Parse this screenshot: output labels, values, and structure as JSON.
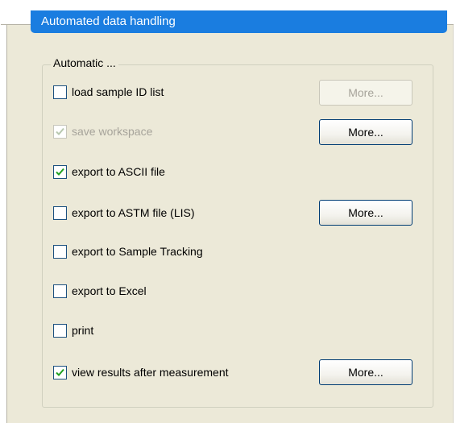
{
  "panel": {
    "title": "Automated data handling"
  },
  "group": {
    "legend": "Automatic ..."
  },
  "options": [
    {
      "label": "load sample ID list",
      "checked": false,
      "enabled": true,
      "more_button": "More...",
      "more_enabled": false
    },
    {
      "label": "save workspace",
      "checked": true,
      "enabled": false,
      "more_button": "More...",
      "more_enabled": true
    },
    {
      "label": "export to ASCII file",
      "checked": true,
      "enabled": true
    },
    {
      "label": "export to ASTM file (LIS)",
      "checked": false,
      "enabled": true,
      "more_button": "More...",
      "more_enabled": true
    },
    {
      "label": "export to Sample Tracking",
      "checked": false,
      "enabled": true
    },
    {
      "label": "export to Excel",
      "checked": false,
      "enabled": true
    },
    {
      "label": "print",
      "checked": false,
      "enabled": true
    },
    {
      "label": "view results after measurement",
      "checked": true,
      "enabled": true,
      "more_button": "More...",
      "more_enabled": true
    }
  ],
  "colors": {
    "title_bar": "#1a7de0",
    "panel_background": "#ece9d8",
    "checkbox_border": "#1c5180",
    "disabled_text": "#a6a39a"
  }
}
